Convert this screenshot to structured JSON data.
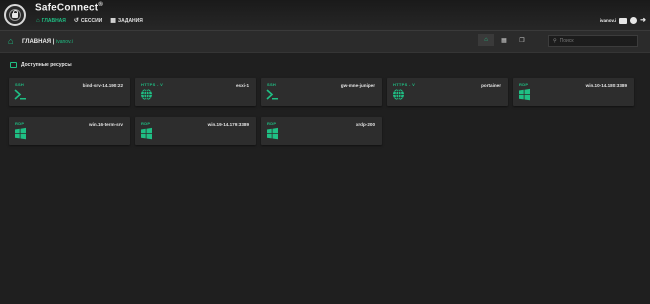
{
  "app": {
    "brand": "SafeConnect",
    "brand_mark": "®"
  },
  "nav": [
    {
      "label": "ГЛАВНАЯ",
      "icon": "home-icon",
      "active": true
    },
    {
      "label": "СЕССИИ",
      "icon": "history-icon",
      "active": false
    },
    {
      "label": "ЗАДАНИЯ",
      "icon": "calendar-icon",
      "active": false
    }
  ],
  "user": {
    "name": "ivanov.i"
  },
  "header": {
    "title": "ГЛАВНАЯ",
    "separator": " | ",
    "user": "ivanov.i",
    "search_placeholder": "Поиск"
  },
  "section": {
    "title": "Доступные ресурсы"
  },
  "resources": [
    {
      "protocol": "SSH",
      "name": "bind-srv-14.190:22",
      "icon": "terminal-icon"
    },
    {
      "protocol": "HTTPS - V",
      "name": "esxi-1",
      "icon": "globe-icon"
    },
    {
      "protocol": "SSH",
      "name": "gw-mne-juniper",
      "icon": "terminal-icon"
    },
    {
      "protocol": "HTTPS - V",
      "name": "portainer",
      "icon": "globe-icon"
    },
    {
      "protocol": "RDP",
      "name": "win.10-14.180:3389",
      "icon": "windows-icon"
    },
    {
      "protocol": "RDP",
      "name": "win.16-term-srv",
      "icon": "windows-icon"
    },
    {
      "protocol": "RDP",
      "name": "win.19-14.179:3389",
      "icon": "windows-icon"
    },
    {
      "protocol": "RDP",
      "name": "xrdp-200",
      "icon": "windows-icon"
    }
  ],
  "colors": {
    "accent": "#1fbf84",
    "background": "#1f1f1f",
    "card": "#2d2d2d"
  }
}
